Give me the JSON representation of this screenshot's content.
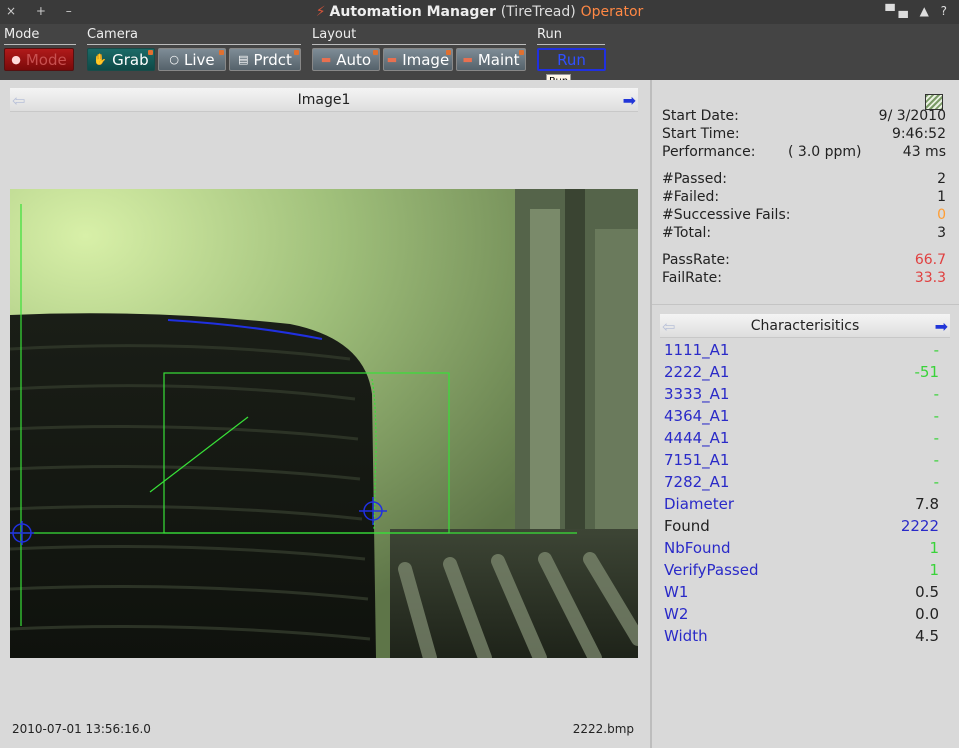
{
  "window": {
    "controls": "× + –",
    "app_name": "Automation Manager",
    "project": "(TireTread)",
    "role": "Operator",
    "right_icons": "▀▄ ▲ ?"
  },
  "toolbar": {
    "groups": [
      {
        "label": "Mode"
      },
      {
        "label": "Camera"
      },
      {
        "label": "Layout"
      },
      {
        "label": "Run"
      }
    ],
    "buttons": {
      "mode": "Mode",
      "grab": "Grab",
      "live": "Live",
      "prdct": "Prdct",
      "auto": "Auto",
      "image": "Image",
      "maint": "Maint",
      "run": "Run"
    },
    "tooltip": "Run"
  },
  "image_panel": {
    "title": "Image1",
    "timestamp": "2010-07-01 13:56:16.0",
    "filename": "2222.bmp"
  },
  "stats": {
    "start_date_label": "Start Date:",
    "start_date": "9/ 3/2010",
    "start_time_label": "Start Time:",
    "start_time": "9:46:52",
    "performance_label": "Performance:",
    "performance_ppm": "(  3.0 ppm)",
    "performance_ms": "43 ms",
    "passed_label": "#Passed:",
    "passed": "2",
    "failed_label": "#Failed:",
    "failed": "1",
    "successive_fails_label": "#Successive Fails:",
    "successive_fails": "0",
    "total_label": "#Total:",
    "total": "3",
    "pass_rate_label": "PassRate:",
    "pass_rate": "66.7",
    "fail_rate_label": "FailRate:",
    "fail_rate": "33.3"
  },
  "characteristics": {
    "title": "Characterisitics",
    "items": [
      {
        "label": "1111_A1",
        "value": "-"
      },
      {
        "label": "2222_A1",
        "value": "-51"
      },
      {
        "label": "3333_A1",
        "value": "-"
      },
      {
        "label": "4364_A1",
        "value": "-"
      },
      {
        "label": "4444_A1",
        "value": "-"
      },
      {
        "label": "7151_A1",
        "value": "-"
      },
      {
        "label": "7282_A1",
        "value": "-"
      },
      {
        "label": "Diameter",
        "value": "7.8"
      },
      {
        "label": "Found",
        "value": "2222"
      },
      {
        "label": "NbFound",
        "value": "1"
      },
      {
        "label": "VerifyPassed",
        "value": "1"
      },
      {
        "label": "W1",
        "value": "0.5"
      },
      {
        "label": "W2",
        "value": "0.0"
      },
      {
        "label": "Width",
        "value": "4.5"
      }
    ]
  },
  "colors": {
    "accent_blue": "#2a2ac8",
    "green": "#39d339",
    "red": "#e04040",
    "orange": "#ff9d33",
    "overlay_green": "#38e038"
  }
}
